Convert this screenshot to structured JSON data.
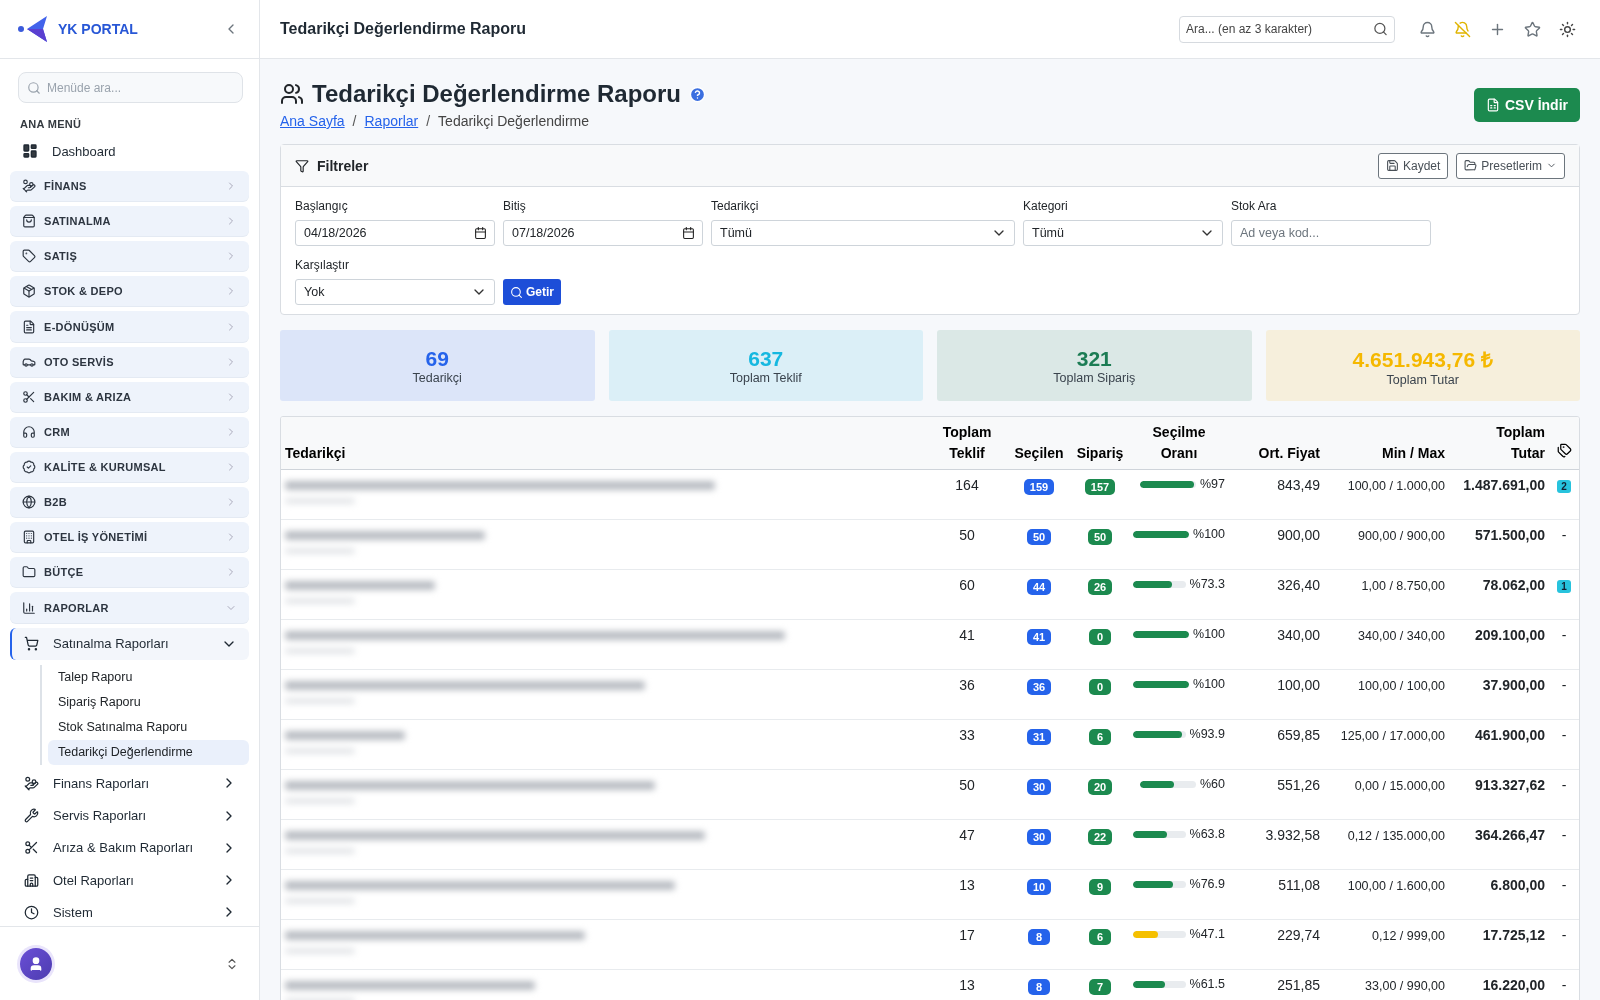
{
  "brand": {
    "name": "YK PORTAL"
  },
  "sidebar": {
    "search": {
      "placeholder": "Menüde ara..."
    },
    "section_label": "ANA MENÜ",
    "items": [
      {
        "kind": "plain",
        "label": "Dashboard"
      },
      {
        "kind": "group",
        "label": "FİNANS",
        "expanded": false
      },
      {
        "kind": "group",
        "label": "SATINALMA",
        "expanded": false
      },
      {
        "kind": "group",
        "label": "SATIŞ",
        "expanded": false
      },
      {
        "kind": "group",
        "label": "STOK & DEPO",
        "expanded": false
      },
      {
        "kind": "group",
        "label": "E-DÖNÜŞÜM",
        "expanded": false
      },
      {
        "kind": "group",
        "label": "OTO SERVİS",
        "expanded": false
      },
      {
        "kind": "group",
        "label": "BAKIM & ARIZA",
        "expanded": false
      },
      {
        "kind": "group",
        "label": "CRM",
        "expanded": false
      },
      {
        "kind": "group",
        "label": "KALİTE & KURUMSAL",
        "expanded": false
      },
      {
        "kind": "group",
        "label": "B2B",
        "expanded": false
      },
      {
        "kind": "group",
        "label": "OTEL İŞ YÖNETİMİ",
        "expanded": false
      },
      {
        "kind": "group",
        "label": "BÜTÇE",
        "expanded": false
      },
      {
        "kind": "group",
        "label": "RAPORLAR",
        "expanded": true,
        "children": [
          {
            "label": "Satınalma Raporları",
            "expanded": true,
            "children": [
              {
                "label": "Talep Raporu",
                "selected": false
              },
              {
                "label": "Sipariş Raporu",
                "selected": false
              },
              {
                "label": "Stok Satınalma Raporu",
                "selected": false
              },
              {
                "label": "Tedarikçi Değerlendirme",
                "selected": true
              }
            ]
          },
          {
            "label": "Finans Raporları",
            "expanded": false
          },
          {
            "label": "Servis Raporları",
            "expanded": false
          },
          {
            "label": "Arıza & Bakım Raporları",
            "expanded": false
          },
          {
            "label": "Otel Raporları",
            "expanded": false
          },
          {
            "label": "Sistem",
            "expanded": false
          }
        ]
      }
    ]
  },
  "topbar": {
    "title": "Tedarikçi Değerlendirme Raporu",
    "search": {
      "placeholder": "Ara... (en az 3 karakter)"
    }
  },
  "page": {
    "title": "Tedarikçi Değerlendirme Raporu",
    "breadcrumb_separator": "/",
    "breadcrumb": [
      {
        "label": "Ana Sayfa",
        "link": true
      },
      {
        "label": "Raporlar",
        "link": true
      },
      {
        "label": "Tedarikçi Değerlendirme",
        "link": false
      }
    ],
    "export_button": "CSV İndir"
  },
  "filters": {
    "title": "Filtreler",
    "save_button": "Kaydet",
    "presets_button": "Presetlerim",
    "fields": [
      {
        "kind": "date",
        "label": "Başlangıç",
        "value": "04/18/2026"
      },
      {
        "kind": "date",
        "label": "Bitiş",
        "value": "07/18/2026"
      },
      {
        "kind": "select",
        "label": "Tedarikçi",
        "value": "Tümü"
      },
      {
        "kind": "select",
        "label": "Kategori",
        "value": "Tümü"
      },
      {
        "kind": "text",
        "label": "Stok Ara",
        "placeholder": "Ad veya kod..."
      },
      {
        "kind": "select",
        "label": "Karşılaştır",
        "value": "Yok"
      }
    ],
    "submit_button": "Getir"
  },
  "stats": [
    {
      "value": "69",
      "label": "Tedarikçi",
      "color": "#2563eb"
    },
    {
      "value": "637",
      "label": "Toplam Teklif",
      "color": "#16b8e0"
    },
    {
      "value": "321",
      "label": "Toplam Sipariş",
      "color": "#1c7c54"
    },
    {
      "value": "4.651.943,76 ₺",
      "label": "Toplam Tutar",
      "color": "#f5b800"
    }
  ],
  "table": {
    "columns": [
      "Tedarikçi",
      "Toplam Teklif",
      "Seçilen",
      "Sipariş",
      "Seçilme Oranı",
      "Ort. Fiyat",
      "Min / Max",
      "Toplam Tutar"
    ],
    "rows": [
      {
        "name_blurred": true,
        "offers": "164",
        "selected_count": "159",
        "orders": "157",
        "level": 0.97,
        "ratio": "%97",
        "avg": "843,49",
        "minmax": "100,00 / 1.000,00",
        "total": "1.487.691,00",
        "tag": {
          "kind": "badge",
          "text": "2"
        }
      },
      {
        "name_blurred": true,
        "offers": "50",
        "selected_count": "50",
        "orders": "50",
        "level": 1,
        "ratio": "%100",
        "avg": "900,00",
        "minmax": "900,00 / 900,00",
        "total": "571.500,00",
        "tag": {
          "kind": "none",
          "text": "-"
        }
      },
      {
        "name_blurred": true,
        "offers": "60",
        "selected_count": "44",
        "orders": "26",
        "level": 0.733,
        "ratio": "%73.3",
        "avg": "326,40",
        "minmax": "1,00 / 8.750,00",
        "total": "78.062,00",
        "tag": {
          "kind": "badge",
          "text": "1"
        }
      },
      {
        "name_blurred": true,
        "offers": "41",
        "selected_count": "41",
        "orders": "0",
        "level": 1,
        "ratio": "%100",
        "avg": "340,00",
        "minmax": "340,00 / 340,00",
        "total": "209.100,00",
        "tag": {
          "kind": "none",
          "text": "-"
        }
      },
      {
        "name_blurred": true,
        "offers": "36",
        "selected_count": "36",
        "orders": "0",
        "level": 1,
        "ratio": "%100",
        "avg": "100,00",
        "minmax": "100,00 / 100,00",
        "total": "37.900,00",
        "tag": {
          "kind": "none",
          "text": "-"
        }
      },
      {
        "name_blurred": true,
        "offers": "33",
        "selected_count": "31",
        "orders": "6",
        "level": 0.939,
        "ratio": "%93.9",
        "avg": "659,85",
        "minmax": "125,00 / 17.000,00",
        "total": "461.900,00",
        "tag": {
          "kind": "none",
          "text": "-"
        }
      },
      {
        "name_blurred": true,
        "offers": "50",
        "selected_count": "30",
        "orders": "20",
        "level": 0.6,
        "ratio": "%60",
        "avg": "551,26",
        "minmax": "0,00 / 15.000,00",
        "total": "913.327,62",
        "tag": {
          "kind": "none",
          "text": "-"
        }
      },
      {
        "name_blurred": true,
        "offers": "47",
        "selected_count": "30",
        "orders": "22",
        "level": 0.638,
        "ratio": "%63.8",
        "avg": "3.932,58",
        "minmax": "0,12 / 135.000,00",
        "total": "364.266,47",
        "tag": {
          "kind": "none",
          "text": "-"
        }
      },
      {
        "name_blurred": true,
        "offers": "13",
        "selected_count": "10",
        "orders": "9",
        "level": 0.769,
        "ratio": "%76.9",
        "avg": "511,08",
        "minmax": "100,00 / 1.600,00",
        "total": "6.800,00",
        "tag": {
          "kind": "none",
          "text": "-"
        }
      },
      {
        "name_blurred": true,
        "offers": "17",
        "selected_count": "8",
        "orders": "6",
        "level": 0.471,
        "ratio": "%47.1",
        "avg": "229,74",
        "minmax": "0,12 / 999,00",
        "total": "17.725,12",
        "tag": {
          "kind": "none",
          "text": "-"
        }
      },
      {
        "name_blurred": true,
        "offers": "13",
        "selected_count": "8",
        "orders": "7",
        "level": 0.615,
        "ratio": "%61.5",
        "avg": "251,85",
        "minmax": "33,00 / 990,00",
        "total": "16.220,00",
        "tag": {
          "kind": "none",
          "text": "-"
        }
      }
    ]
  }
}
